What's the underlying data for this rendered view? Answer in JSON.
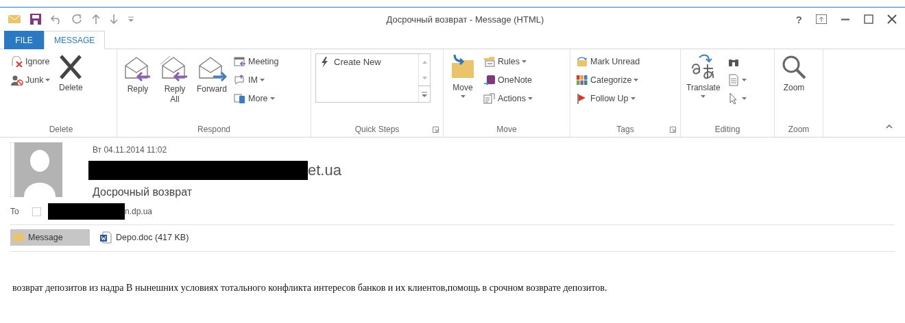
{
  "window": {
    "title": "Досрочный возврат - Message (HTML)",
    "help": "?"
  },
  "tabs": [
    {
      "label": "FILE",
      "selected": false,
      "kind": "file"
    },
    {
      "label": "MESSAGE",
      "selected": true,
      "kind": "tab"
    }
  ],
  "ribbon": {
    "groups": [
      {
        "label": "Delete",
        "launcher": false,
        "items": [
          {
            "kind": "stack",
            "items": [
              {
                "label": "Ignore",
                "dropdown": false
              },
              {
                "label": "Junk",
                "dropdown": true
              }
            ]
          },
          {
            "kind": "large",
            "label": "Delete",
            "dropdown": false
          }
        ]
      },
      {
        "label": "Respond",
        "launcher": false,
        "items": [
          {
            "kind": "large",
            "label": "Reply",
            "dropdown": false
          },
          {
            "kind": "large",
            "label": "Reply All",
            "dropdown": false
          },
          {
            "kind": "large",
            "label": "Forward",
            "dropdown": false
          },
          {
            "kind": "stack",
            "items": [
              {
                "label": "Meeting",
                "dropdown": false
              },
              {
                "label": "IM",
                "dropdown": true
              },
              {
                "label": "More",
                "dropdown": true
              }
            ]
          }
        ]
      },
      {
        "label": "Quick Steps",
        "launcher": true,
        "items": [
          {
            "kind": "gallery",
            "label": "Create New"
          }
        ]
      },
      {
        "label": "Move",
        "launcher": false,
        "items": [
          {
            "kind": "large",
            "label": "Move",
            "dropdown": true
          },
          {
            "kind": "stack",
            "items": [
              {
                "label": "Rules",
                "dropdown": true
              },
              {
                "label": "OneNote",
                "dropdown": false
              },
              {
                "label": "Actions",
                "dropdown": true
              }
            ]
          }
        ]
      },
      {
        "label": "Tags",
        "launcher": true,
        "items": [
          {
            "kind": "stack",
            "items": [
              {
                "label": "Mark Unread",
                "dropdown": false
              },
              {
                "label": "Categorize",
                "dropdown": true
              },
              {
                "label": "Follow Up",
                "dropdown": true
              }
            ]
          }
        ]
      },
      {
        "label": "Editing",
        "launcher": false,
        "items": [
          {
            "kind": "large",
            "label": "Translate",
            "dropdown": true
          },
          {
            "kind": "stack",
            "items": [
              {
                "dropdown": false
              },
              {
                "dropdown": true
              },
              {
                "dropdown": true
              }
            ]
          }
        ]
      },
      {
        "label": "Zoom",
        "launcher": false,
        "items": [
          {
            "kind": "large",
            "label": "Zoom",
            "dropdown": false
          }
        ]
      }
    ]
  },
  "message": {
    "date": "Вт 04.11.2014 11:02",
    "sender": "et.ua",
    "sender_redacted": true,
    "subject": "Досрочный возврат",
    "to_label": "To",
    "recipient": "n.dp.ua",
    "recipient_redacted": true,
    "recipient_checked": false,
    "attachments": [
      {
        "label": "Message",
        "selected": true,
        "kind": "message"
      },
      {
        "label": "Depo.doc (417 KB)",
        "selected": false,
        "kind": "doc"
      }
    ],
    "body": "возврат депозитов из надра В нынешних условиях тотального конфликта интересов банков и их клиентов,помощь в срочном возврате депозитов."
  }
}
